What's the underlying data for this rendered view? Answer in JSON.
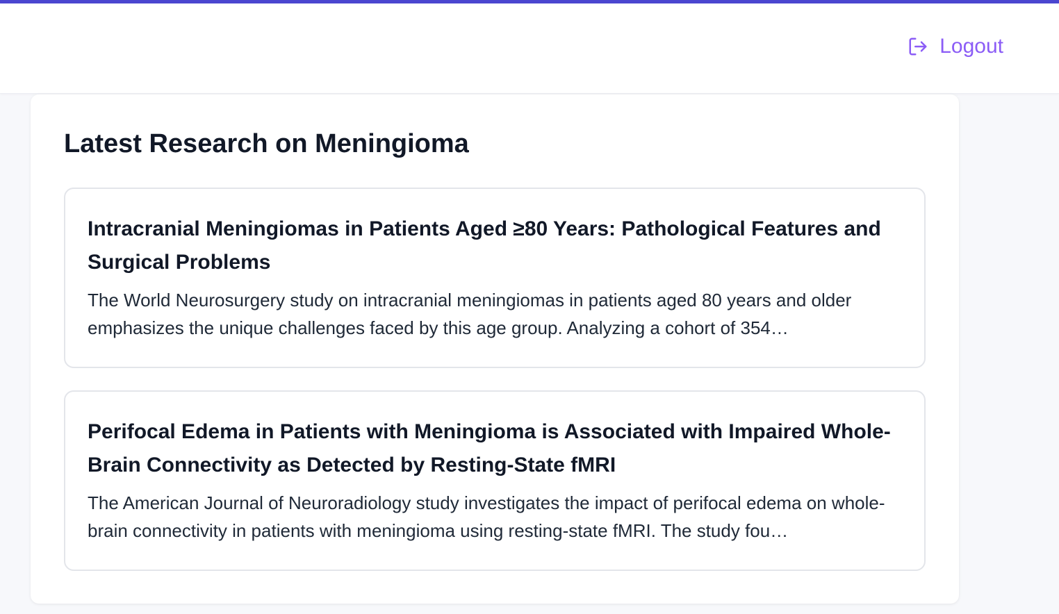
{
  "header": {
    "logout_label": "Logout"
  },
  "research": {
    "title": "Latest Research on Meningioma",
    "articles": [
      {
        "title": "Intracranial Meningiomas in Patients Aged ≥80 Years: Pathological Features and Surgical Problems",
        "summary": "The World Neurosurgery study on intracranial meningiomas in patients aged 80 years and older emphasizes the unique challenges faced by this age group. Analyzing a cohort of 354…"
      },
      {
        "title": "Perifocal Edema in Patients with Meningioma is Associated with Impaired Whole-Brain Connectivity as Detected by Resting-State fMRI",
        "summary": "The American Journal of Neuroradiology study investigates the impact of perifocal edema on whole-brain connectivity in patients with meningioma using resting-state fMRI. The study fou…"
      }
    ]
  },
  "colors": {
    "accent": "#4b46d0",
    "logout": "#8b5cf6"
  },
  "icons": {
    "logout": "logout-icon"
  }
}
